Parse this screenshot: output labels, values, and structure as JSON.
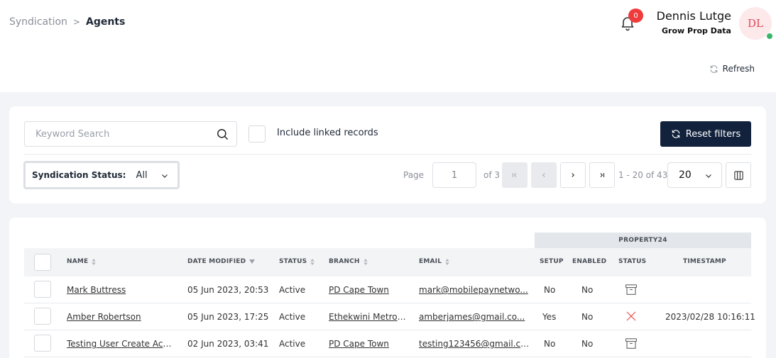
{
  "breadcrumb": {
    "parent": "Syndication",
    "current": "Agents"
  },
  "notifications": {
    "count": "0"
  },
  "user": {
    "name": "Dennis Lutge",
    "org": "Grow Prop Data",
    "initials": "DL"
  },
  "toolbar": {
    "refresh_label": "Refresh"
  },
  "filters": {
    "search_placeholder": "Keyword Search",
    "linked_label": "Include linked records",
    "reset_label": "Reset filters",
    "status_label": "Syndication Status:",
    "status_value": "All"
  },
  "pager": {
    "page_label": "Page",
    "page_value": "1",
    "of_label": "of 3",
    "range_label": "1 - 20 of 43",
    "page_size": "20"
  },
  "table": {
    "group_header": "PROPERTY24",
    "columns": {
      "name": "NAME",
      "date_modified": "DATE MODIFIED",
      "status": "STATUS",
      "branch": "BRANCH",
      "email": "EMAIL",
      "setup": "SETUP",
      "enabled": "ENABLED",
      "p24_status": "STATUS",
      "timestamp": "TIMESTAMP"
    },
    "rows": [
      {
        "name": "Mark Buttress",
        "date": "05 Jun 2023, 20:53",
        "status": "Active",
        "branch": "PD Cape Town",
        "email": "mark@mobilepaynetwo...",
        "setup": "No",
        "enabled": "No",
        "p24_icon": "archive-icon",
        "timestamp": ""
      },
      {
        "name": "Amber Robertson",
        "date": "05 Jun 2023, 17:25",
        "status": "Active",
        "branch": "Ethekwini Metro ...",
        "email": "amberjames@gmail.co...",
        "setup": "Yes",
        "enabled": "No",
        "p24_icon": "error-x-icon",
        "timestamp": "2023/02/28 10:16:11"
      },
      {
        "name": "Testing User Create Acti...",
        "date": "02 Jun 2023, 03:41",
        "status": "Active",
        "branch": "PD Cape Town",
        "email": "testing123456@gmail.co...",
        "setup": "No",
        "enabled": "No",
        "p24_icon": "archive-icon",
        "timestamp": ""
      }
    ]
  },
  "colors": {
    "accent_dark": "#12223d",
    "badge_red": "#ef3b3b",
    "online_green": "#3bb56b",
    "error_red": "#e8534f"
  }
}
